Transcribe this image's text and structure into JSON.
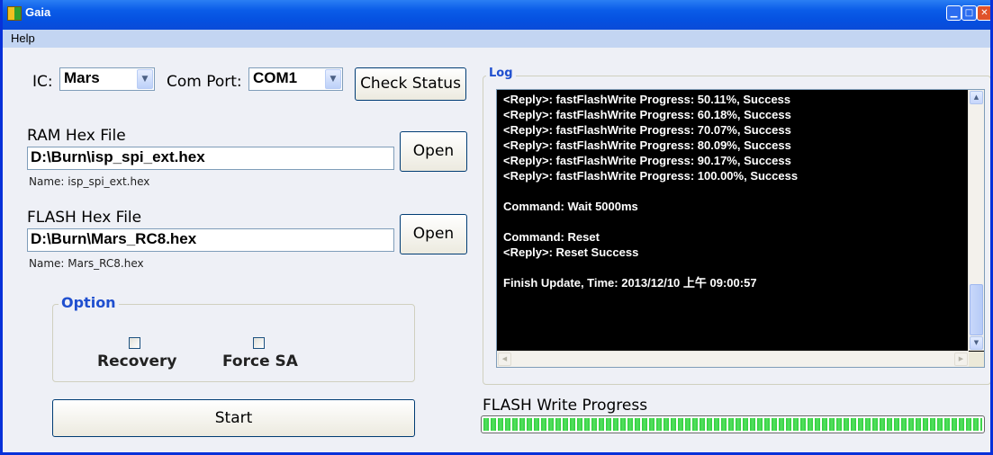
{
  "window": {
    "title": "Gaia"
  },
  "menu": {
    "help": "Help"
  },
  "ic": {
    "label": "IC:",
    "value": "Mars"
  },
  "com_port": {
    "label": "Com Port:",
    "value": "COM1"
  },
  "buttons": {
    "check_status": "Check Status",
    "open_ram": "Open",
    "open_flash": "Open",
    "start": "Start"
  },
  "ram": {
    "label": "RAM Hex File",
    "path": "D:\\Burn\\isp_spi_ext.hex",
    "name": "Name: isp_spi_ext.hex"
  },
  "flash": {
    "label": "FLASH Hex File",
    "path": "D:\\Burn\\Mars_RC8.hex",
    "name": "Name: Mars_RC8.hex"
  },
  "option": {
    "title": "Option",
    "recovery": "Recovery",
    "force_sa": "Force SA"
  },
  "log": {
    "title": "Log",
    "lines": [
      "<Reply>: fastFlashWrite Progress: 50.11%, Success",
      "<Reply>: fastFlashWrite Progress: 60.18%, Success",
      "<Reply>: fastFlashWrite Progress: 70.07%, Success",
      "<Reply>: fastFlashWrite Progress: 80.09%, Success",
      "<Reply>: fastFlashWrite Progress: 90.17%, Success",
      "<Reply>: fastFlashWrite Progress: 100.00%, Success",
      "",
      "Command: Wait 5000ms",
      "",
      "Command: Reset",
      "<Reply>: Reset Success",
      "",
      "Finish Update, Time: 2013/12/10 上午 09:00:57"
    ]
  },
  "progress": {
    "label": "FLASH Write Progress",
    "percent": 100
  },
  "colors": {
    "titlebar": "#0a5ce8",
    "progress_fill": "#2fcf3c",
    "log_bg": "#000000",
    "option_title": "#1f4fcf"
  }
}
